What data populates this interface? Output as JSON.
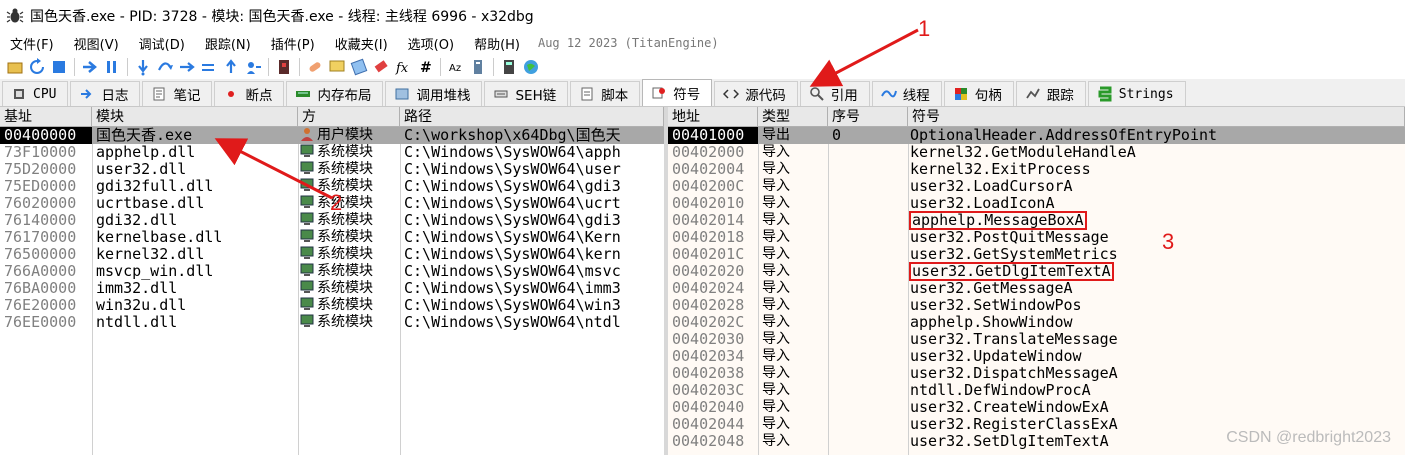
{
  "window": {
    "title": "国色天香.exe - PID: 3728 - 模块: 国色天香.exe - 线程: 主线程 6996 - x32dbg",
    "icon": "bug-icon"
  },
  "menu": {
    "items": [
      "文件(F)",
      "视图(V)",
      "调试(D)",
      "跟踪(N)",
      "插件(P)",
      "收藏夹(I)",
      "选项(O)",
      "帮助(H)"
    ],
    "extra": "Aug 12 2023 (TitanEngine)"
  },
  "toolbar": {
    "icons": [
      "open-icon",
      "restart-icon",
      "stop-icon",
      "run-icon",
      "pause-icon",
      "step-into-icon",
      "step-over-icon",
      "trace-into-icon",
      "trace-over-icon",
      "execute-till-return-icon",
      "run-to-user-code-icon",
      "scylla-icon",
      "patch-icon",
      "comments-icon",
      "labels-icon",
      "bookmarks-icon",
      "function-icon",
      "hash-icon",
      "font-icon",
      "memory-icon",
      "calculator-icon",
      "globe-icon"
    ]
  },
  "tabs": [
    {
      "label": "CPU",
      "icon": "cpu-icon",
      "mono": true
    },
    {
      "label": "日志",
      "icon": "log-icon"
    },
    {
      "label": "笔记",
      "icon": "notes-icon"
    },
    {
      "label": "断点",
      "icon": "breakpoint-icon"
    },
    {
      "label": "内存布局",
      "icon": "memory-map-icon"
    },
    {
      "label": "调用堆栈",
      "icon": "callstack-icon"
    },
    {
      "label": "SEH链",
      "icon": "seh-icon"
    },
    {
      "label": "脚本",
      "icon": "script-icon"
    },
    {
      "label": "符号",
      "icon": "symbols-icon",
      "active": true
    },
    {
      "label": "源代码",
      "icon": "source-icon"
    },
    {
      "label": "引用",
      "icon": "references-icon"
    },
    {
      "label": "线程",
      "icon": "threads-icon"
    },
    {
      "label": "句柄",
      "icon": "handles-icon"
    },
    {
      "label": "跟踪",
      "icon": "trace-icon"
    },
    {
      "label": "Strings",
      "icon": "strings-icon",
      "mono": true
    }
  ],
  "modules": {
    "headers": [
      "基址",
      "模块",
      "方",
      "路径"
    ],
    "rows": [
      {
        "base": "00400000",
        "module": "国色天香.exe",
        "party": "用户模块",
        "party_type": "user",
        "path": "C:\\workshop\\x64Dbg\\国色天",
        "selected": true
      },
      {
        "base": "73F10000",
        "module": "apphelp.dll",
        "party": "系统模块",
        "party_type": "system",
        "path": "C:\\Windows\\SysWOW64\\apph"
      },
      {
        "base": "75D20000",
        "module": "user32.dll",
        "party": "系统模块",
        "party_type": "system",
        "path": "C:\\Windows\\SysWOW64\\user"
      },
      {
        "base": "75ED0000",
        "module": "gdi32full.dll",
        "party": "系统模块",
        "party_type": "system",
        "path": "C:\\Windows\\SysWOW64\\gdi3"
      },
      {
        "base": "76020000",
        "module": "ucrtbase.dll",
        "party": "系统模块",
        "party_type": "system",
        "path": "C:\\Windows\\SysWOW64\\ucrt"
      },
      {
        "base": "76140000",
        "module": "gdi32.dll",
        "party": "系统模块",
        "party_type": "system",
        "path": "C:\\Windows\\SysWOW64\\gdi3"
      },
      {
        "base": "76170000",
        "module": "kernelbase.dll",
        "party": "系统模块",
        "party_type": "system",
        "path": "C:\\Windows\\SysWOW64\\Kern"
      },
      {
        "base": "76500000",
        "module": "kernel32.dll",
        "party": "系统模块",
        "party_type": "system",
        "path": "C:\\Windows\\SysWOW64\\kern"
      },
      {
        "base": "766A0000",
        "module": "msvcp_win.dll",
        "party": "系统模块",
        "party_type": "system",
        "path": "C:\\Windows\\SysWOW64\\msvc"
      },
      {
        "base": "76BA0000",
        "module": "imm32.dll",
        "party": "系统模块",
        "party_type": "system",
        "path": "C:\\Windows\\SysWOW64\\imm3"
      },
      {
        "base": "76E20000",
        "module": "win32u.dll",
        "party": "系统模块",
        "party_type": "system",
        "path": "C:\\Windows\\SysWOW64\\win3"
      },
      {
        "base": "76EE0000",
        "module": "ntdll.dll",
        "party": "系统模块",
        "party_type": "system",
        "path": "C:\\Windows\\SysWOW64\\ntdl"
      }
    ]
  },
  "symbols": {
    "headers": [
      "地址",
      "类型",
      "序号",
      "符号"
    ],
    "rows": [
      {
        "addr": "00401000",
        "type": "导出",
        "ordinal": "0",
        "symbol": "OptionalHeader.AddressOfEntryPoint",
        "selected": true
      },
      {
        "addr": "00402000",
        "type": "导入",
        "ordinal": "",
        "symbol": "kernel32.GetModuleHandleA"
      },
      {
        "addr": "00402004",
        "type": "导入",
        "ordinal": "",
        "symbol": "kernel32.ExitProcess"
      },
      {
        "addr": "0040200C",
        "type": "导入",
        "ordinal": "",
        "symbol": "user32.LoadCursorA"
      },
      {
        "addr": "00402010",
        "type": "导入",
        "ordinal": "",
        "symbol": "user32.LoadIconA"
      },
      {
        "addr": "00402014",
        "type": "导入",
        "ordinal": "",
        "symbol": "apphelp.MessageBoxA",
        "boxed": true
      },
      {
        "addr": "00402018",
        "type": "导入",
        "ordinal": "",
        "symbol": "user32.PostQuitMessage"
      },
      {
        "addr": "0040201C",
        "type": "导入",
        "ordinal": "",
        "symbol": "user32.GetSystemMetrics"
      },
      {
        "addr": "00402020",
        "type": "导入",
        "ordinal": "",
        "symbol": "user32.GetDlgItemTextA",
        "boxed": true
      },
      {
        "addr": "00402024",
        "type": "导入",
        "ordinal": "",
        "symbol": "user32.GetMessageA"
      },
      {
        "addr": "00402028",
        "type": "导入",
        "ordinal": "",
        "symbol": "user32.SetWindowPos"
      },
      {
        "addr": "0040202C",
        "type": "导入",
        "ordinal": "",
        "symbol": "apphelp.ShowWindow"
      },
      {
        "addr": "00402030",
        "type": "导入",
        "ordinal": "",
        "symbol": "user32.TranslateMessage"
      },
      {
        "addr": "00402034",
        "type": "导入",
        "ordinal": "",
        "symbol": "user32.UpdateWindow"
      },
      {
        "addr": "00402038",
        "type": "导入",
        "ordinal": "",
        "symbol": "user32.DispatchMessageA"
      },
      {
        "addr": "0040203C",
        "type": "导入",
        "ordinal": "",
        "symbol": "ntdll.DefWindowProcA"
      },
      {
        "addr": "00402040",
        "type": "导入",
        "ordinal": "",
        "symbol": "user32.CreateWindowExA"
      },
      {
        "addr": "00402044",
        "type": "导入",
        "ordinal": "",
        "symbol": "user32.RegisterClassExA"
      },
      {
        "addr": "00402048",
        "type": "导入",
        "ordinal": "",
        "symbol": "user32.SetDlgItemTextA"
      }
    ]
  },
  "annotations": {
    "label1": "1",
    "label2": "2",
    "label3": "3",
    "color": "#e01a1a"
  },
  "watermark": "CSDN @redbright2023"
}
